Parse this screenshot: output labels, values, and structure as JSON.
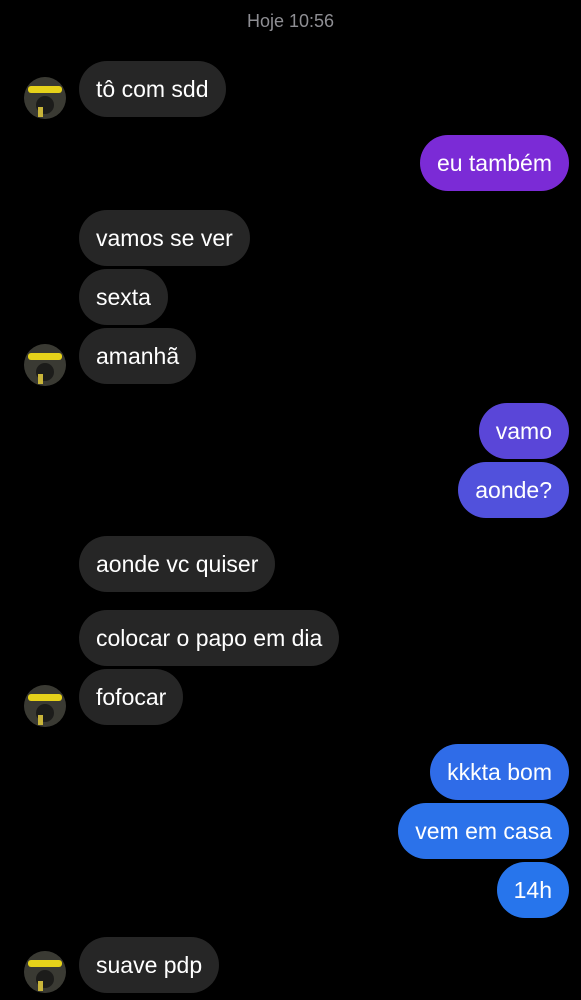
{
  "chat": {
    "timestamp": "Hoje 10:56",
    "messages": [
      {
        "side": "in",
        "text": "tô com sdd"
      },
      {
        "side": "out",
        "text": "eu também",
        "color": "#7b2bd6"
      },
      {
        "side": "in",
        "text": "vamos se ver"
      },
      {
        "side": "in",
        "text": "sexta"
      },
      {
        "side": "in",
        "text": "amanhã"
      },
      {
        "side": "out",
        "text": "vamo",
        "color": "#5a46d8"
      },
      {
        "side": "out",
        "text": "aonde?",
        "color": "#5151dc"
      },
      {
        "side": "in",
        "text": "aonde vc quiser"
      },
      {
        "side": "in",
        "text": "colocar o papo em dia"
      },
      {
        "side": "in",
        "text": "fofocar"
      },
      {
        "side": "out",
        "text": "kkkta bom",
        "color": "#2f6ce8"
      },
      {
        "side": "out",
        "text": "vem em casa",
        "color": "#2b72ea"
      },
      {
        "side": "out",
        "text": "14h",
        "color": "#2775ec"
      },
      {
        "side": "in",
        "text": "suave pdp"
      }
    ],
    "contact_avatar_icon": "contact-avatar-icon",
    "incoming_bubble_color": "#262626",
    "background_color": "#000000"
  }
}
